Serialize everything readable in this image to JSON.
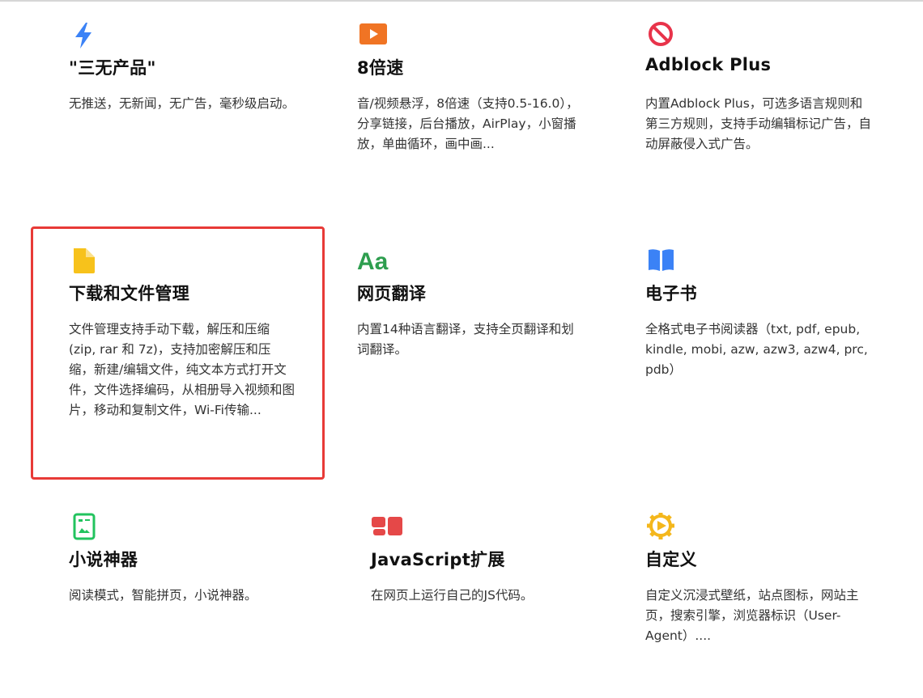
{
  "features": [
    {
      "id": "no-three",
      "icon": "lightning-icon",
      "title": "\"三无产品\"",
      "desc": "无推送，无新闻，无广告，毫秒级启动。"
    },
    {
      "id": "speed",
      "icon": "play-icon",
      "title": "8倍速",
      "desc": "音/视频悬浮，8倍速（支持0.5-16.0），分享链接，后台播放，AirPlay，小窗播放，单曲循环，画中画..."
    },
    {
      "id": "adblock",
      "icon": "block-icon",
      "title": "Adblock Plus",
      "desc": "内置Adblock Plus，可选多语言规则和第三方规则，支持手动编辑标记广告，自动屏蔽侵入式广告。"
    },
    {
      "id": "download",
      "icon": "file-icon",
      "title": "下载和文件管理",
      "desc": "文件管理支持手动下载，解压和压缩(zip, rar 和 7z)，支持加密解压和压缩，新建/编辑文件，纯文本方式打开文件，文件选择编码，从相册导入视频和图片，移动和复制文件，Wi-Fi传输..."
    },
    {
      "id": "translate",
      "icon": "translate-icon",
      "icon_text": "Aa",
      "title": "网页翻译",
      "desc": "内置14种语言翻译，支持全页翻译和划词翻译。"
    },
    {
      "id": "ebook",
      "icon": "book-icon",
      "title": "电子书",
      "desc": "全格式电子书阅读器（txt, pdf, epub, kindle, mobi, azw, azw3, azw4, prc, pdb）"
    },
    {
      "id": "novel",
      "icon": "reader-icon",
      "title": "小说神器",
      "desc": "阅读模式，智能拼页，小说神器。"
    },
    {
      "id": "javascript",
      "icon": "extension-icon",
      "title": "JavaScript扩展",
      "desc": "在网页上运行自己的JS代码。"
    },
    {
      "id": "custom",
      "icon": "gear-icon",
      "title": "自定义",
      "desc": "自定义沉浸式壁纸，站点图标，网站主页，搜索引擎，浏览器标识（User-Agent）...."
    }
  ],
  "colors": {
    "lightning": "#3b82f6",
    "play": "#f07424",
    "block": "#e8334a",
    "file": "#f7c21b",
    "translate": "#2e9e4f",
    "book": "#3b82f6",
    "reader": "#22c35e",
    "extension": "#e54848",
    "gear": "#f4b71c",
    "highlight": "#e83a37"
  }
}
